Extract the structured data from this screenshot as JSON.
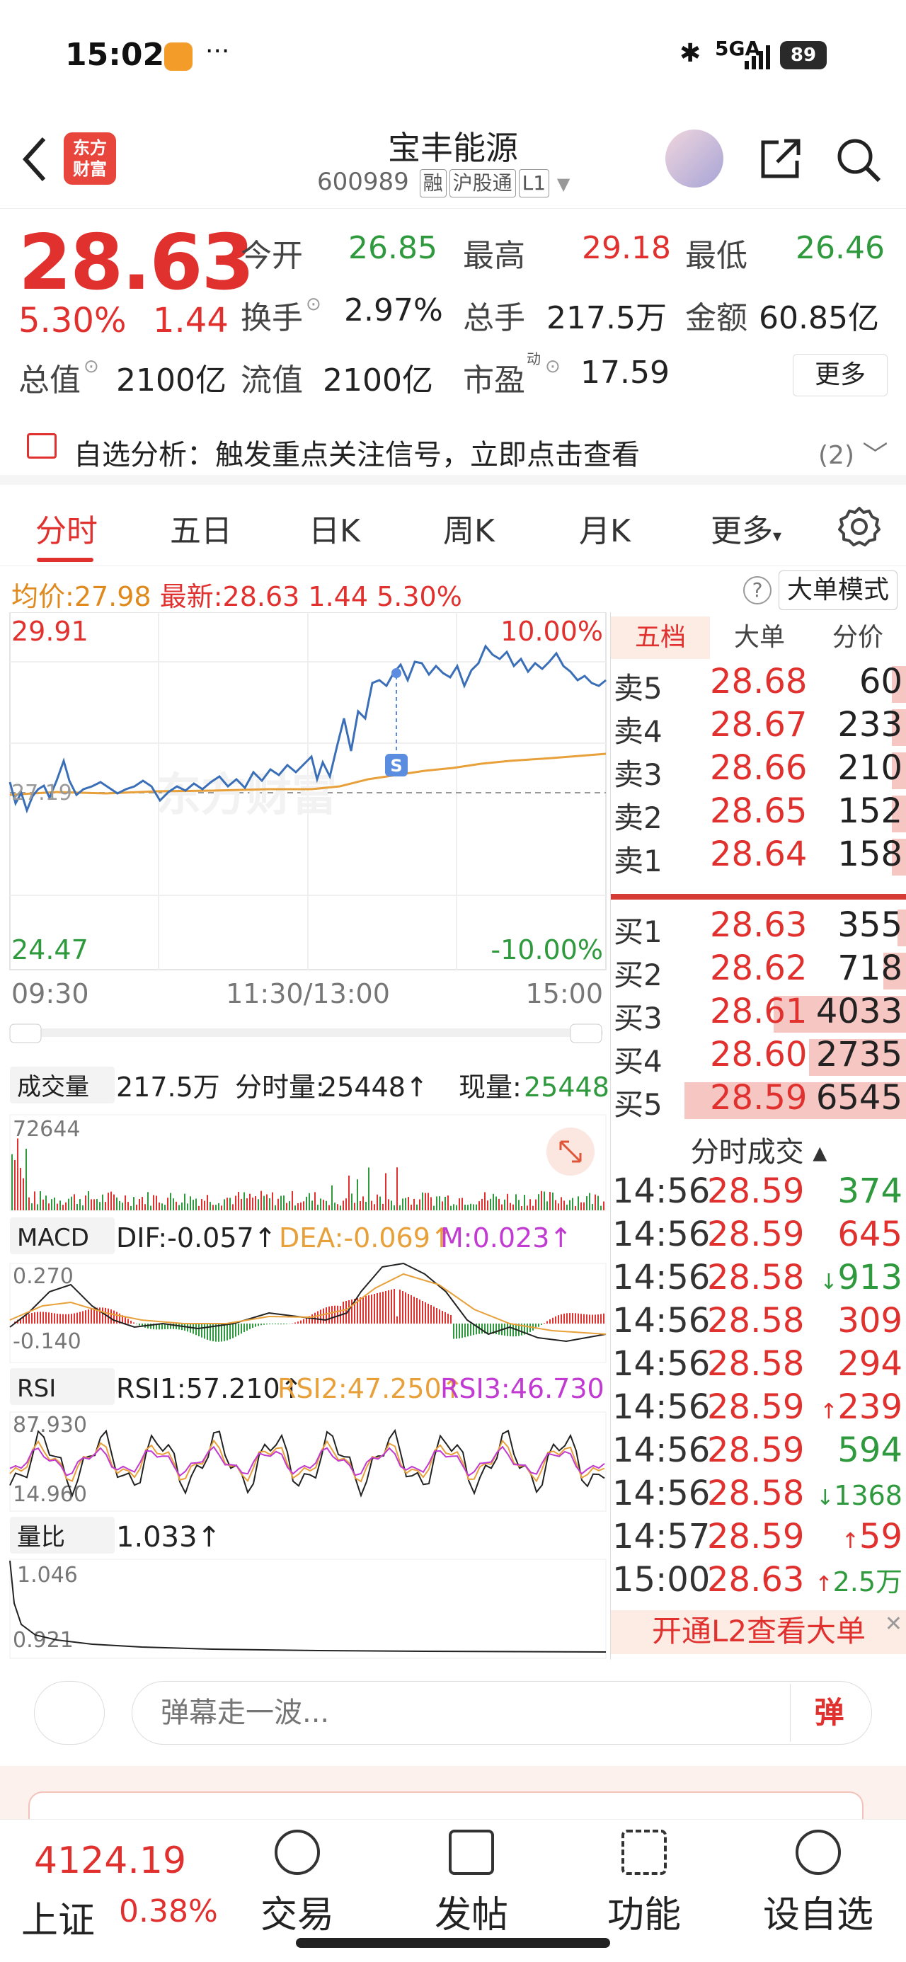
{
  "status_bar": {
    "time": "15:02",
    "more": "···",
    "network": "5GA",
    "battery": "89"
  },
  "header": {
    "logo_line1": "东方",
    "logo_line2": "财富",
    "title": "宝丰能源",
    "code": "600989",
    "tags": [
      "融",
      "沪股通",
      "L1"
    ]
  },
  "quote": {
    "price": "28.63",
    "change_pct": "5.30%",
    "change": "1.44",
    "open_label": "今开",
    "open": "26.85",
    "high_label": "最高",
    "high": "29.18",
    "low_label": "最低",
    "low": "26.46",
    "turnover_label": "换手",
    "turnover": "2.97%",
    "volume_label": "总手",
    "volume": "217.5万",
    "amount_label": "金额",
    "amount": "60.85亿",
    "mktcap_label": "总值",
    "mktcap": "2100亿",
    "float_label": "流值",
    "float_cap": "2100亿",
    "pe_label": "市盈",
    "pe_sup": "动",
    "pe": "17.59",
    "more_button": "更多"
  },
  "alert": {
    "text": "自选分析：触发重点关注信号，立即点击查看",
    "count": "(2)"
  },
  "tabs": [
    "分时",
    "五日",
    "日K",
    "周K",
    "月K",
    "更多"
  ],
  "infobar": {
    "avg_label": "均价:",
    "avg": "27.98",
    "latest_label": "最新:",
    "latest": "28.63",
    "chg": "1.44",
    "pct": "5.30%",
    "help": "?",
    "mode_button": "大单模式"
  },
  "chart": {
    "y_high": "29.91",
    "y_high_pct": "10.00%",
    "y_low": "24.47",
    "y_low_pct": "-10.00%",
    "y_mid": "27.19",
    "times": [
      "09:30",
      "11:30/13:00",
      "15:00"
    ],
    "signal_label": "S",
    "watermark": "东方财富"
  },
  "volume_panel": {
    "select": "成交量",
    "total": "217.5万",
    "fenshi_label": "分时量:",
    "fenshi": "25448↑",
    "now_label": "现量:",
    "now": "25448",
    "max": "72644"
  },
  "macd_panel": {
    "select": "MACD",
    "dif": "DIF:-0.057↑",
    "dea": "DEA:-0.069↑",
    "m": "M:0.023↑",
    "top": "0.270",
    "bottom": "-0.140"
  },
  "rsi_panel": {
    "select": "RSI",
    "rsi1": "RSI1:57.210↑",
    "rsi2": "RSI2:47.250↑",
    "rsi3": "RSI3:46.730↑",
    "top": "87.930",
    "bottom": "14.960"
  },
  "lb_panel": {
    "select": "量比",
    "value": "1.033↑",
    "top": "1.046",
    "bottom": "0.921"
  },
  "order_book": {
    "tabs": [
      "五档",
      "大单",
      "分价"
    ],
    "asks": [
      {
        "label": "卖5",
        "price": "28.68",
        "vol": "60",
        "bar": 0.05
      },
      {
        "label": "卖4",
        "price": "28.67",
        "vol": "233",
        "bar": 0.05
      },
      {
        "label": "卖3",
        "price": "28.66",
        "vol": "210",
        "bar": 0.05
      },
      {
        "label": "卖2",
        "price": "28.65",
        "vol": "152",
        "bar": 0.05
      },
      {
        "label": "卖1",
        "price": "28.64",
        "vol": "158",
        "bar": 0.05
      }
    ],
    "bids": [
      {
        "label": "买1",
        "price": "28.63",
        "vol": "355",
        "bar": 0.03
      },
      {
        "label": "买2",
        "price": "28.62",
        "vol": "718",
        "bar": 0.08
      },
      {
        "label": "买3",
        "price": "28.61",
        "vol": "4033",
        "bar": 0.45
      },
      {
        "label": "买4",
        "price": "28.60",
        "vol": "2735",
        "bar": 0.33
      },
      {
        "label": "买5",
        "price": "28.59",
        "vol": "6545",
        "bar": 0.75
      }
    ],
    "trades_header": "分时成交 ▴",
    "trades": [
      {
        "time": "14:56",
        "price": "28.59",
        "vol": "374",
        "dir": "",
        "color": "green"
      },
      {
        "time": "14:56",
        "price": "28.59",
        "vol": "645",
        "dir": "",
        "color": "red"
      },
      {
        "time": "14:56",
        "price": "28.58",
        "vol": "913",
        "dir": "↓",
        "color": "green"
      },
      {
        "time": "14:56",
        "price": "28.58",
        "vol": "309",
        "dir": "",
        "color": "red"
      },
      {
        "time": "14:56",
        "price": "28.58",
        "vol": "294",
        "dir": "",
        "color": "red"
      },
      {
        "time": "14:56",
        "price": "28.59",
        "vol": "239",
        "dir": "↑",
        "color": "red"
      },
      {
        "time": "14:56",
        "price": "28.59",
        "vol": "594",
        "dir": "",
        "color": "green"
      },
      {
        "time": "14:56",
        "price": "28.58",
        "vol": "1368",
        "dir": "↓",
        "color": "green"
      },
      {
        "time": "14:57",
        "price": "28.59",
        "vol": "59",
        "dir": "↑",
        "color": "red"
      },
      {
        "time": "15:00",
        "price": "28.63",
        "vol": "2.5万",
        "dir": "↑",
        "color": "green"
      }
    ],
    "l2_banner": "开通L2查看大单"
  },
  "comment_bar": {
    "placeholder": "弹幕走一波...",
    "send": "弹"
  },
  "bottom_nav": {
    "index_value": "4124.19",
    "index_name": "上证",
    "index_pct": "0.38%",
    "items": [
      "交易",
      "发帖",
      "功能",
      "设自选"
    ]
  },
  "colors": {
    "up": "#e0312f",
    "down": "#2e9a3d",
    "price_line": "#3a6fb8",
    "avg_line": "#e8a03a"
  }
}
